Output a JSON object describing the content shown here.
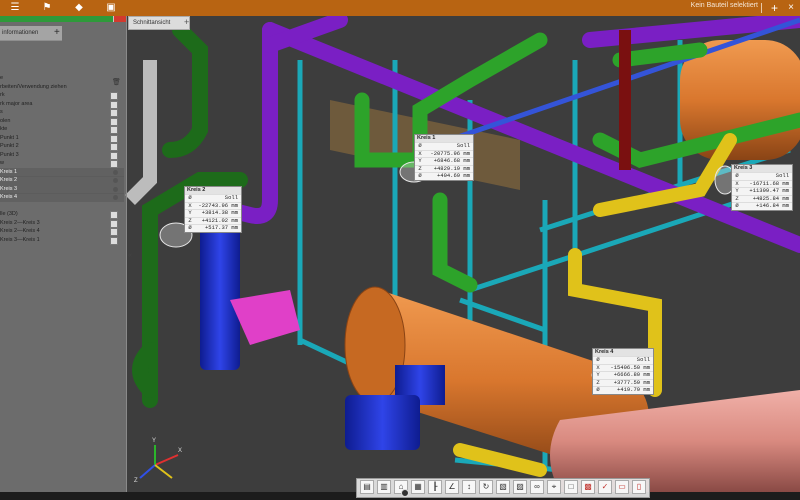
{
  "toolbar": {
    "icons": [
      "menu-icon",
      "pin-icon",
      "diamond-icon",
      "camera-icon"
    ],
    "glyphs": [
      "☰",
      "⚑",
      "◆",
      "▣"
    ],
    "status": "Kein Bauteil selektiert",
    "plus": "+",
    "close": "×"
  },
  "left_panel": {
    "progress": 0.9,
    "tab_label": "informationen",
    "tab_plus": "+",
    "items": [
      {
        "label": "e",
        "state": "none"
      },
      {
        "label": "rbeiten/Verwendung ziehen",
        "state": "none"
      },
      {
        "label": "rk",
        "state": "box"
      },
      {
        "label": "rk major area",
        "state": "box"
      },
      {
        "label": "s",
        "state": "box"
      },
      {
        "label": "olen",
        "state": "box"
      },
      {
        "label": "kte",
        "state": "box"
      },
      {
        "label": "Punkt 1",
        "state": "box"
      },
      {
        "label": "Punkt 2",
        "state": "box"
      },
      {
        "label": "Punkt 3",
        "state": "box"
      },
      {
        "label": "w",
        "state": "box"
      },
      {
        "label": "Kreis 1",
        "state": "eye",
        "highlight": true
      },
      {
        "label": "Kreis 2",
        "state": "eye",
        "highlight": true
      },
      {
        "label": "Kreis 3",
        "state": "eye",
        "highlight": true
      },
      {
        "label": "Kreis 4",
        "state": "eye",
        "highlight": true
      },
      {
        "label": "",
        "state": "none"
      },
      {
        "label": "lle (3D)",
        "state": "box"
      },
      {
        "label": "Kreis 2—Kreis 3",
        "state": "box"
      },
      {
        "label": "Kreis 2—Kreis 4",
        "state": "box"
      },
      {
        "label": "Kreis 3—Kreis 1",
        "state": "box"
      }
    ],
    "collapse": "«"
  },
  "view_tab": {
    "label": "Schnittansicht",
    "plus": "+"
  },
  "measurements": [
    {
      "title": "Kreis 2",
      "soll": "Soll",
      "X": "-22743.96 mm",
      "Y": "+3814.38 mm",
      "Z": "+4121.02 mm",
      "D": "+517.37 mm"
    },
    {
      "title": "Kreis 1",
      "soll": "Soll",
      "X": "-20775.96 mm",
      "Y": "+6846.68 mm",
      "Z": "+4829.19 mm",
      "D": "+404.69 mm"
    },
    {
      "title": "Kreis 3",
      "soll": "Soll",
      "X": "-16711.68 mm",
      "Y": "+11399.47 mm",
      "Z": "+4825.84 mm",
      "D": "+146.84 mm"
    },
    {
      "title": "Kreis 4",
      "soll": "Soll",
      "X": "-15406.50 mm",
      "Y": "+6666.80 mm",
      "Z": "+3777.59 mm",
      "D": "+419.79 mm"
    }
  ],
  "row_keys": {
    "X": "X",
    "Y": "Y",
    "Z": "Z",
    "D": "Ø",
    "head": "Ø"
  },
  "axis": {
    "x": "X",
    "y": "Y",
    "z": "Z"
  },
  "bottom_toolbar": {
    "icons": [
      "camera-view-icon",
      "camera-view-icon",
      "home-icon",
      "film-icon",
      "ruler-icon",
      "angle-icon",
      "measure-icon",
      "rotate-icon",
      "section-icon",
      "grid-icon",
      "link-icon",
      "axis-icon",
      "box-icon",
      "highlight-icon",
      "check-icon",
      "doc-icon",
      "file-icon"
    ],
    "glyphs": [
      "▤",
      "▥",
      "⌂",
      "▦",
      "┠",
      "∠",
      "↕",
      "↻",
      "▧",
      "▨",
      "∞",
      "⌖",
      "□",
      "▩",
      "✓",
      "▭",
      "▯"
    ]
  },
  "colors": {
    "accent": "#b86412",
    "pipe_purple": "#7a1fc4",
    "pipe_green": "#2da32a",
    "pipe_yellow": "#e0c21a",
    "tank_orange": "#d9772e",
    "frame_cyan": "#1aa8b8",
    "pump_blue": "#1c2fd0"
  }
}
